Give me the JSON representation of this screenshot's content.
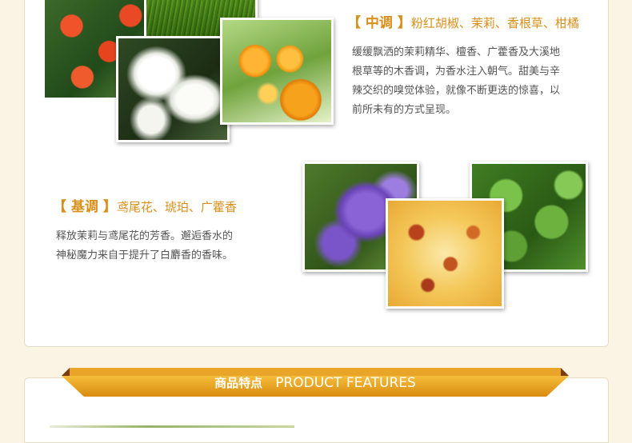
{
  "middle_note": {
    "label": "【 中调 】",
    "ingredients": "粉红胡椒、茉莉、香根草、柑橘",
    "description_lines": [
      "缓缓飘洒的茉莉精华、檀香、广藿香及大溪地",
      "根草等的木香调，为香水注入朝气。甜美与辛",
      "辣交织的嗅觉体验，就像不断更迭的惊喜，以",
      "前所未有的方式呈现。"
    ]
  },
  "base_note": {
    "label": "【 基调 】",
    "ingredients": "鸢尾花、琥珀、广藿香",
    "description_lines": [
      "释放茉莉与鸢尾花的芳香。邂逅香水的",
      "神秘魔力来自于提升了白麝香的香味。"
    ]
  },
  "section_banner": {
    "title_cn": "商品特点",
    "title_en": "PRODUCT FEATURES"
  },
  "images": {
    "middle": [
      "red-flower-photo",
      "green-grass-photo",
      "white-jasmine-photo",
      "orange-citrus-photo"
    ],
    "base": [
      "purple-iris-photo",
      "amber-photo",
      "green-leaves-photo"
    ]
  },
  "colors": {
    "accent": "#d98f1a",
    "background": "#fbf3e4",
    "ribbon": "#e8a21a"
  }
}
